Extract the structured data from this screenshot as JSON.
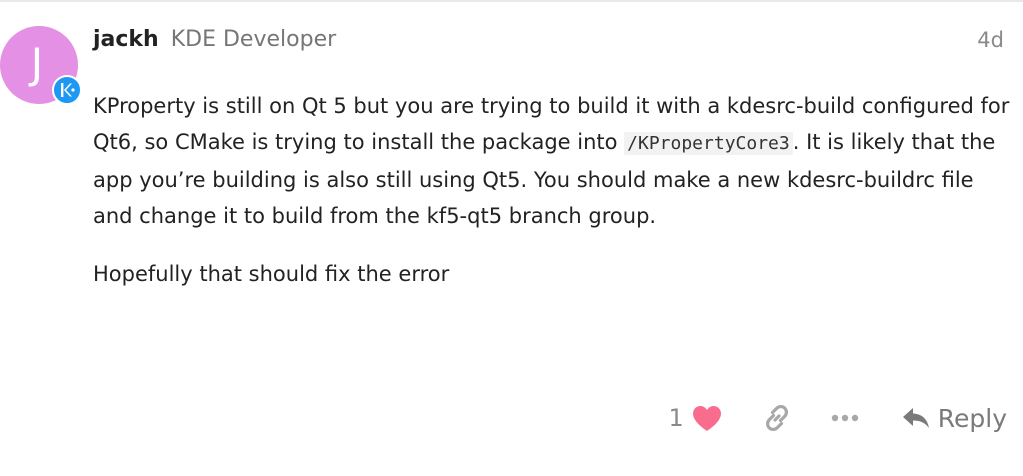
{
  "post": {
    "avatar_letter": "J",
    "username": "jackh",
    "user_title": "KDE Developer",
    "date": "4d",
    "body": {
      "p1_part1": "KProperty is still on Qt 5 but you are trying to build it with a kdesrc-build configured for Qt6, so CMake is trying to install the package into ",
      "p1_code": "/KPropertyCore3",
      "p1_part2": ". It is likely that the app you’re building is also still using Qt5. You should make a new kdesrc-buildrc file and change it to build from the kf5-qt5 branch group.",
      "p2": "Hopefully that should fix the error"
    },
    "actions": {
      "like_count": "1",
      "reply_label": "Reply"
    }
  },
  "icons": {
    "flair": "kde-logo-icon",
    "like": "heart-icon",
    "share": "link-icon",
    "more": "ellipsis-icon",
    "reply": "reply-arrow-icon"
  },
  "colors": {
    "avatar_bg": "#e490e4",
    "flair_bg": "#1d99f3",
    "heart": "#fa6c8d",
    "muted": "#8a8a8a"
  }
}
